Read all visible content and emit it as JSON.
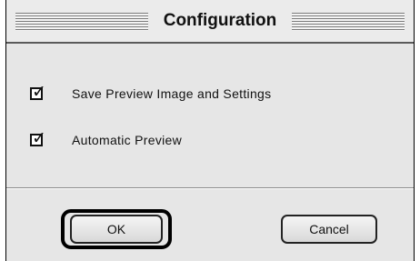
{
  "dialog": {
    "title": "Configuration"
  },
  "options": [
    {
      "label": "Save Preview Image and Settings",
      "checked": true
    },
    {
      "label": "Automatic Preview",
      "checked": true
    }
  ],
  "buttons": {
    "ok_label": "OK",
    "cancel_label": "Cancel"
  },
  "icons": {
    "checkmark": "check-icon"
  }
}
